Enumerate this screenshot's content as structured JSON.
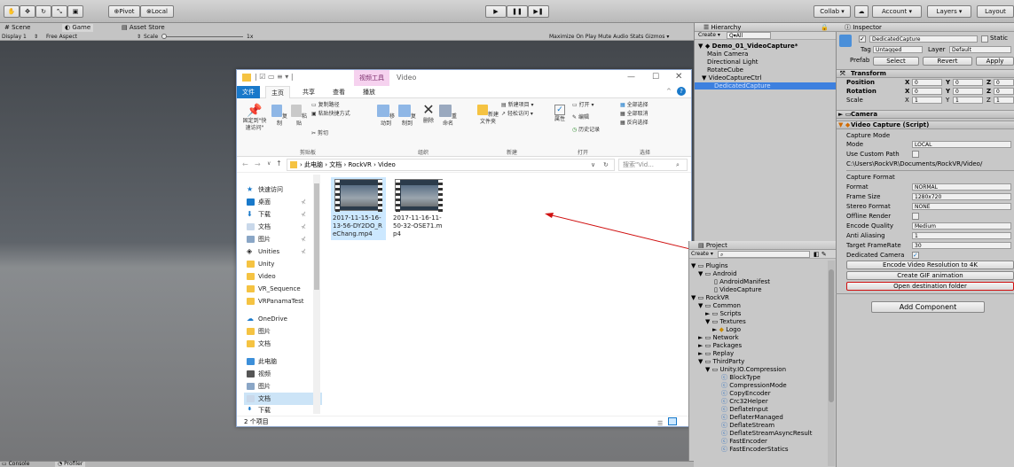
{
  "toolbar": {
    "pivot": "Pivot",
    "local": "Local",
    "collab": "Collab ▾",
    "account": "Account ▾",
    "layers": "Layers ▾",
    "layout": "Layout"
  },
  "tabs": {
    "scene": "Scene",
    "game": "Game",
    "asset_store": "Asset Store",
    "display": "Display 1",
    "aspect": "Free Aspect",
    "scale_label": "Scale",
    "scale_value": "1x",
    "game_options": "Maximize On Play  Mute Audio  Stats  Gizmos ▾"
  },
  "explorer": {
    "ribbon_tool_tab": "视频工具",
    "title": "Video",
    "tabs": [
      "文件",
      "主页",
      "共享",
      "查看",
      "播放"
    ],
    "ribbon": {
      "pin": "固定到\"快\n速访问\"",
      "copy": "复制",
      "paste": "粘贴",
      "copy_path": "复制路径",
      "paste_shortcut": "粘贴快捷方式",
      "cut": "剪切",
      "move_to": "移动到",
      "copy_to": "复制到",
      "delete": "删除",
      "rename": "重命名",
      "new_folder": "新建\n文件夹",
      "new_item": "新建项目 ▾",
      "easy_access": "轻松访问 ▾",
      "properties": "属性",
      "open": "打开 ▾",
      "edit": "编辑",
      "history": "历史记录",
      "select_all": "全部选择",
      "select_none": "全部取消",
      "invert": "反向选择",
      "groups": [
        "剪贴板",
        "组织",
        "新建",
        "打开",
        "选择"
      ]
    },
    "path": [
      "此电脑",
      "文档",
      "RockVR",
      "Video"
    ],
    "search_placeholder": "搜索\"Vid...",
    "nav": [
      "快速访问",
      "桌面",
      "下载",
      "文档",
      "图片",
      "Unities",
      "Unity",
      "Video",
      "VR_Sequence",
      "VRPanamaTest",
      "OneDrive",
      "图片",
      "文档",
      "此电脑",
      "视频",
      "图片",
      "文档",
      "下载"
    ],
    "files": [
      {
        "name": "2017-11-15-16-13-56-DY2DO_ReChang.mp4"
      },
      {
        "name": "2017-11-16-11-50-32-OSE71.mp4"
      }
    ],
    "status": "2 个项目"
  },
  "hierarchy": {
    "title": "Hierarchy",
    "create": "Create ▾",
    "search": "Q▾All",
    "scene": "Demo_01_VideoCapture*",
    "items": [
      "Main Camera",
      "Directional Light",
      "RotateCube",
      "VideoCaptureCtrl",
      "DedicatedCapture"
    ]
  },
  "project": {
    "title": "Project",
    "create": "Create ▾",
    "items": [
      "Plugins",
      "Android",
      "AndroidManifest",
      "VideoCapture",
      "RockVR",
      "Common",
      "Scripts",
      "Textures",
      "Logo",
      "Network",
      "Packages",
      "Replay",
      "ThirdParty",
      "Unity.IO.Compression",
      "BlockType",
      "CompressionMode",
      "CopyEncoder",
      "Crc32Helper",
      "DeflateInput",
      "DeflaterManaged",
      "DeflateStream",
      "DeflateStreamAsyncResult",
      "FastEncoder",
      "FastEncoderStatics"
    ]
  },
  "inspector": {
    "title": "Inspector",
    "object_name": "DedicatedCapture",
    "static": "Static",
    "tag_label": "Tag",
    "tag": "Untagged",
    "layer_label": "Layer",
    "layer": "Default",
    "prefab": "Prefab",
    "select": "Select",
    "revert": "Revert",
    "apply": "Apply",
    "transform": "Transform",
    "position": "Position",
    "rotation": "Rotation",
    "scale": "Scale",
    "pos": [
      "0",
      "0",
      "0"
    ],
    "rot": [
      "0",
      "0",
      "0"
    ],
    "scl": [
      "1",
      "1",
      "1"
    ],
    "camera": "Camera",
    "video_capture": "Video Capture (Script)",
    "capture_mode": "Capture Mode",
    "mode_label": "Mode",
    "mode": "LOCAL",
    "use_custom_path": "Use Custom Path",
    "path": "C:\\Users\\RockVR\\Documents/RockVR/Video/",
    "capture_format": "Capture Format",
    "format_label": "Format",
    "format": "NORMAL",
    "frame_size_label": "Frame Size",
    "frame_size": "1280x720",
    "stereo_label": "Stereo Format",
    "stereo": "NONE",
    "offline_label": "Offline Render",
    "quality_label": "Encode Quality",
    "quality": "Medium",
    "aa_label": "Anti Aliasing",
    "aa": "1",
    "fps_label": "Target FrameRate",
    "fps": "30",
    "dedicated_label": "Dedicated Camera",
    "btn_4k": "Encode Video Resolution to 4K",
    "btn_gif": "Create GIF animation",
    "btn_open": "Open destination folder",
    "add_component": "Add Component"
  },
  "bottom": {
    "console": "Console",
    "profiler": "Profiler"
  },
  "colors": {
    "accent_red": "#d01010",
    "selection_blue": "#3d80df",
    "explorer_blue": "#1979ca"
  }
}
